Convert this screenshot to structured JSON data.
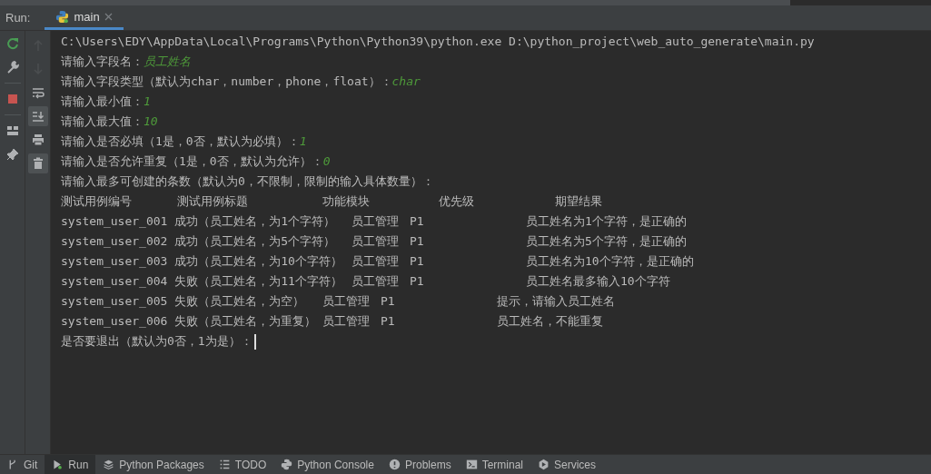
{
  "run_panel": {
    "label": "Run:",
    "tabs": [
      {
        "label": "main",
        "selected": true,
        "closable": true
      }
    ]
  },
  "side_toolbar": [
    {
      "kind": "rerun",
      "disabled": false
    },
    {
      "kind": "wrench",
      "disabled": false
    },
    {
      "kind": "stop",
      "disabled": false
    },
    {
      "kind": "layout",
      "disabled": false
    },
    {
      "kind": "pin",
      "disabled": false
    }
  ],
  "console_toolbar": [
    {
      "kind": "up",
      "disabled": true
    },
    {
      "kind": "down",
      "disabled": true
    },
    {
      "kind": "wrap",
      "disabled": false,
      "selected": false
    },
    {
      "kind": "scroll_end",
      "disabled": false,
      "selected": true
    },
    {
      "kind": "print",
      "disabled": false,
      "selected": false
    },
    {
      "kind": "trash",
      "disabled": false,
      "selected": true
    }
  ],
  "console_lines": [
    {
      "segments": [
        {
          "text": "C:\\Users\\EDY\\AppData\\Local\\Programs\\Python\\Python39\\python.exe D:\\python_project\\web_auto_generate\\main.py",
          "kind": "output"
        }
      ]
    },
    {
      "segments": [
        {
          "text": "请输入字段名：",
          "kind": "output"
        },
        {
          "text": "员工姓名",
          "kind": "input"
        }
      ]
    },
    {
      "segments": [
        {
          "text": "请输入字段类型（默认为char，number，phone，float）：",
          "kind": "output"
        },
        {
          "text": "char",
          "kind": "input"
        }
      ]
    },
    {
      "segments": [
        {
          "text": "请输入最小值：",
          "kind": "output"
        },
        {
          "text": "1",
          "kind": "input"
        }
      ]
    },
    {
      "segments": [
        {
          "text": "请输入最大值：",
          "kind": "output"
        },
        {
          "text": "10",
          "kind": "input"
        }
      ]
    },
    {
      "segments": [
        {
          "text": "请输入是否必填（1是，0否，默认为必填）：",
          "kind": "output"
        },
        {
          "text": "1",
          "kind": "input"
        }
      ]
    },
    {
      "segments": [
        {
          "text": "请输入是否允许重复（1是，0否，默认为允许）：",
          "kind": "output"
        },
        {
          "text": "0",
          "kind": "input"
        }
      ]
    },
    {
      "segments": [
        {
          "text": "请输入最多可创建的条数（默认为0，不限制，限制的输入具体数量）：",
          "kind": "output"
        }
      ]
    },
    {
      "segments": [
        {
          "text": "测试用例编号\t\t测试用例标题\t\t\t功能模块\t\t\t优先级\t\t\t期望结果",
          "kind": "output"
        }
      ]
    },
    {
      "segments": [
        {
          "text": "system_user_001 成功（员工姓名，为1个字符）\t员工管理\tP1\t\t\t\t员工姓名为1个字符，是正确的",
          "kind": "output"
        }
      ]
    },
    {
      "segments": [
        {
          "text": "system_user_002 成功（员工姓名，为5个字符）\t员工管理\tP1\t\t\t\t员工姓名为5个字符，是正确的",
          "kind": "output"
        }
      ]
    },
    {
      "segments": [
        {
          "text": "system_user_003 成功（员工姓名，为10个字符）\t员工管理\tP1\t\t\t\t员工姓名为10个字符，是正确的",
          "kind": "output"
        }
      ]
    },
    {
      "segments": [
        {
          "text": "system_user_004 失败（员工姓名，为11个字符）\t员工管理\tP1\t\t\t\t员工姓名最多输入10个字符",
          "kind": "output"
        }
      ]
    },
    {
      "segments": [
        {
          "text": "system_user_005 失败（员工姓名，为空）\t员工管理\tP1\t\t\t\t提示，请输入员工姓名",
          "kind": "output"
        }
      ]
    },
    {
      "segments": [
        {
          "text": "system_user_006 失败（员工姓名，为重复）\t员工管理\tP1\t\t\t\t员工姓名，不能重复",
          "kind": "output"
        }
      ]
    },
    {
      "segments": [
        {
          "text": "是否要退出（默认为0否，1为是）：",
          "kind": "output"
        }
      ],
      "cursor": true
    }
  ],
  "tool_tabs": [
    {
      "label": "Git",
      "kind": "git",
      "selected": false
    },
    {
      "label": "Run",
      "kind": "run",
      "selected": true
    },
    {
      "label": "Python Packages",
      "kind": "packages",
      "selected": false
    },
    {
      "label": "TODO",
      "kind": "todo",
      "selected": false
    },
    {
      "label": "Python Console",
      "kind": "python",
      "selected": false
    },
    {
      "label": "Problems",
      "kind": "problems",
      "selected": false
    },
    {
      "label": "Terminal",
      "kind": "terminal",
      "selected": false
    },
    {
      "label": "Services",
      "kind": "services",
      "selected": false
    }
  ]
}
